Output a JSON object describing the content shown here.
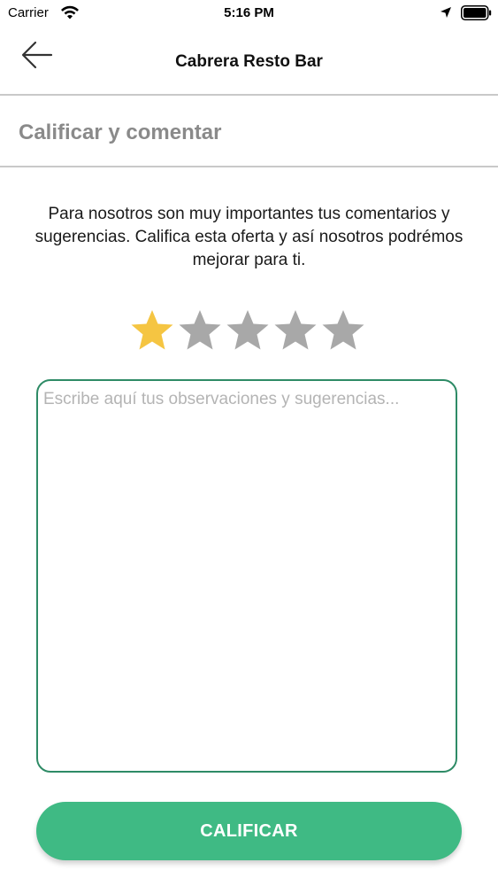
{
  "status_bar": {
    "carrier": "Carrier",
    "time": "5:16 PM",
    "icons": [
      "wifi-icon",
      "location-arrow-icon",
      "battery-icon"
    ]
  },
  "nav": {
    "back_icon": "arrow-left-icon",
    "title": "Cabrera Resto Bar"
  },
  "section": {
    "title": "Calificar y comentar"
  },
  "description": "Para nosotros son muy importantes tus comentarios y sugerencias. Califica esta oferta y así nosotros podrémos mejorar para ti.",
  "rating": {
    "value": 1,
    "max": 5,
    "filled_color": "#f5c542",
    "empty_color": "#a8a8a8"
  },
  "comment": {
    "value": "",
    "placeholder": "Escribe aquí tus observaciones y sugerencias..."
  },
  "submit": {
    "label": "CALIFICAR",
    "color": "#3fba84"
  },
  "colors": {
    "accent_green": "#2e8b66",
    "divider": "#c9c9c9",
    "muted_text": "#8a8a8a"
  }
}
